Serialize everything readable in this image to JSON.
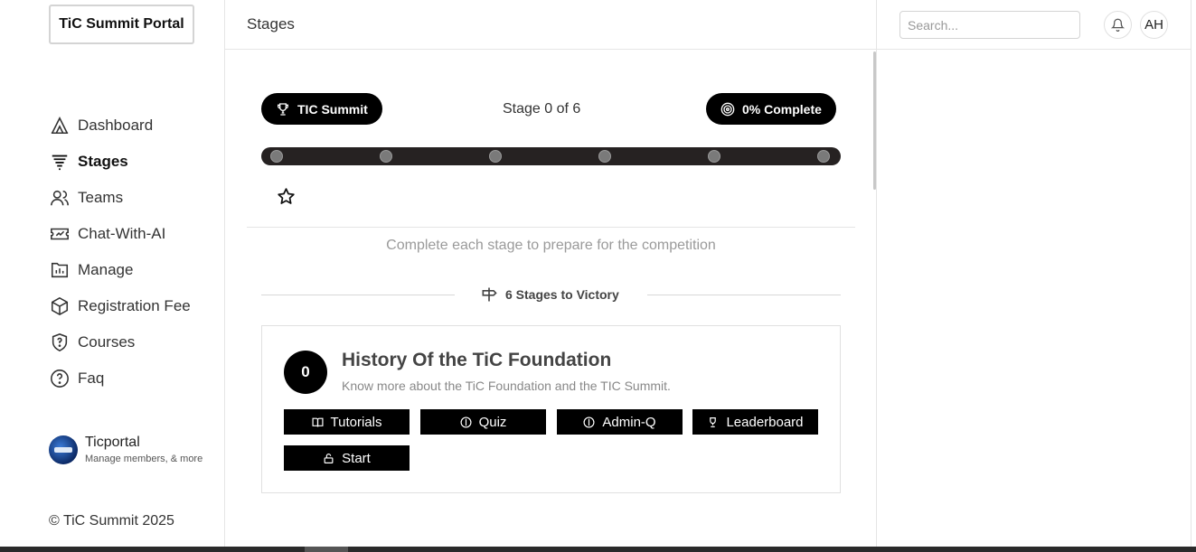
{
  "brand": {
    "title": "TiC Summit Portal"
  },
  "sidebar": {
    "items": [
      {
        "label": "Dashboard",
        "icon": "tent-icon",
        "active": false
      },
      {
        "label": "Stages",
        "icon": "filter-lines-icon",
        "active": true
      },
      {
        "label": "Teams",
        "icon": "users-icon",
        "active": false
      },
      {
        "label": "Chat-With-AI",
        "icon": "ticket-icon",
        "active": false
      },
      {
        "label": "Manage",
        "icon": "folder-chart-icon",
        "active": false
      },
      {
        "label": "Registration Fee",
        "icon": "box-icon",
        "active": false
      },
      {
        "label": "Courses",
        "icon": "shield-question-icon",
        "active": false
      },
      {
        "label": "Faq",
        "icon": "help-circle-icon",
        "active": false
      }
    ],
    "org": {
      "name": "Ticportal",
      "subtitle": "Manage members, & more"
    },
    "copyright": "© TiC Summit 2025"
  },
  "header": {
    "title": "Stages",
    "search_placeholder": "Search...",
    "user_initials": "AH"
  },
  "progress": {
    "summit_label": "TIC Summit",
    "stage_text": "Stage 0 of 6",
    "complete_label": "0% Complete",
    "completed_fraction": 0,
    "stage_dots": 6
  },
  "subtitle": "Complete each stage to prepare for the competition",
  "separator_label": "6 Stages to Victory",
  "stage_card": {
    "number": "0",
    "title": "History Of the TiC Foundation",
    "description": "Know more about the TiC Foundation and the TIC Summit.",
    "buttons": {
      "tutorials": "Tutorials",
      "quiz": "Quiz",
      "admin_q": "Admin-Q",
      "leaderboard": "Leaderboard",
      "start": "Start"
    }
  },
  "colors": {
    "accent": "#000000",
    "track": "#262222",
    "muted_text": "#9a9a9a"
  }
}
